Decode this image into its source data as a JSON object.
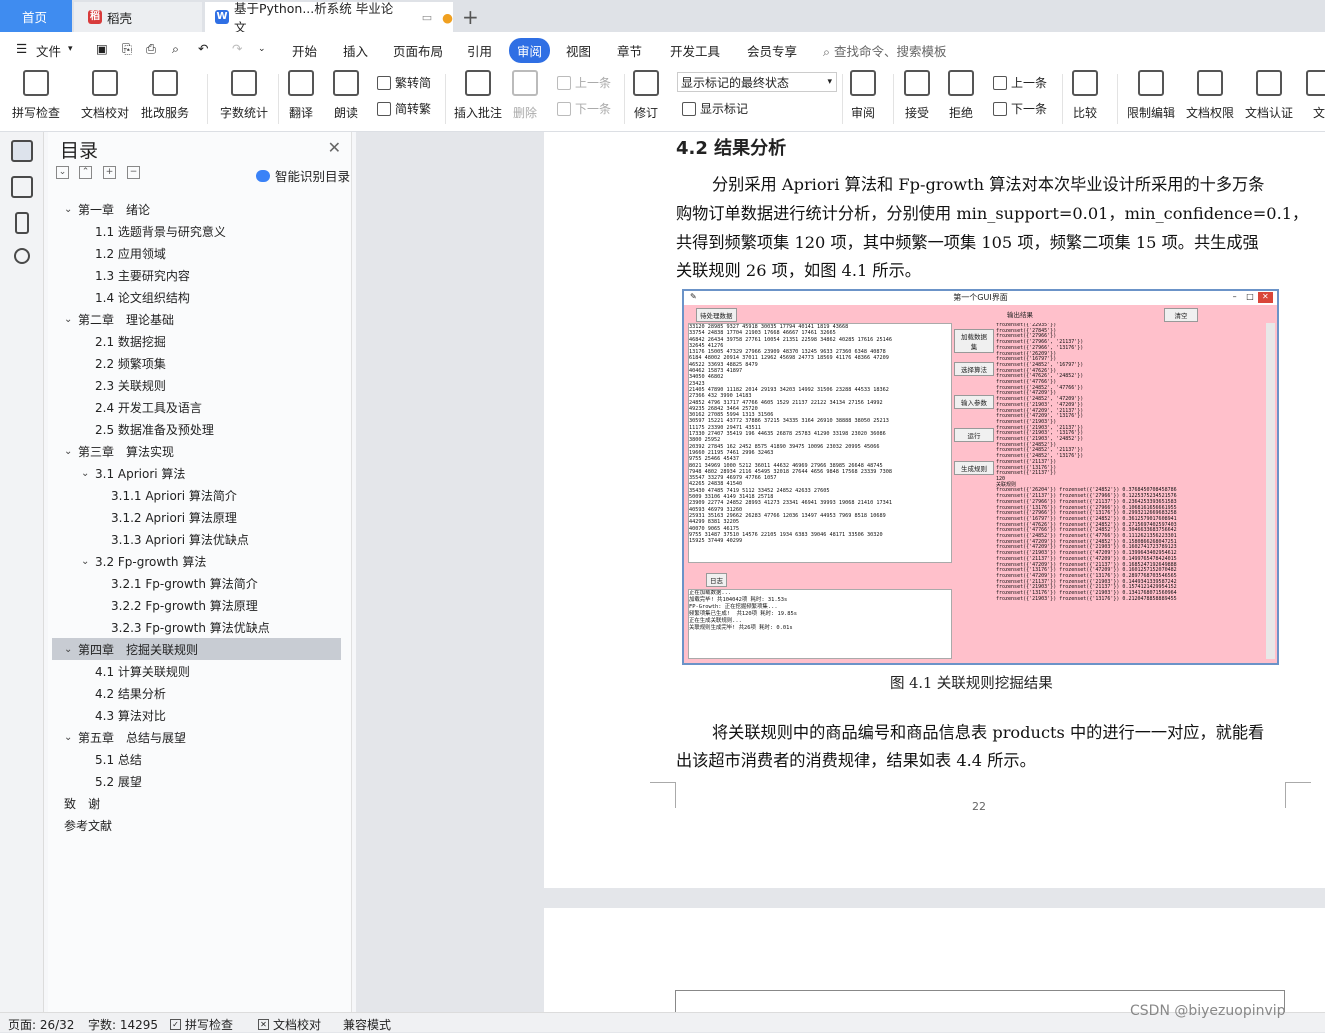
{
  "tabs": {
    "home": "首页",
    "daoke": "稻壳",
    "doc": "基于Python...析系统 毕业论文"
  },
  "menubar": {
    "file": "文件",
    "items": [
      "开始",
      "插入",
      "页面布局",
      "引用",
      "审阅",
      "视图",
      "章节",
      "开发工具",
      "会员专享"
    ],
    "search": "查找命令、搜索模板"
  },
  "ribbon": {
    "spell": "拼写检查",
    "doc_check": "文档校对",
    "annotate_service": "批改服务",
    "word_count": "字数统计",
    "translate": "翻译",
    "read_aloud": "朗读",
    "trad_to_simp": "繁转简",
    "simp_to_trad": "简转繁",
    "insert_comment": "插入批注",
    "delete": "删除",
    "prev_comment": "上一条",
    "next_comment": "下一条",
    "revise": "修订",
    "display_mode": "显示标记的最终状态",
    "show_markup": "显示标记",
    "review": "审阅",
    "accept": "接受",
    "reject": "拒绝",
    "prev": "上一条",
    "next": "下一条",
    "compare": "比较",
    "restrict_edit": "限制编辑",
    "doc_permission": "文档权限",
    "doc_cert": "文档认证",
    "doc_more": "文"
  },
  "toc": {
    "title": "目录",
    "smart_label": "智能识别目录",
    "items": [
      {
        "text": "第一章　绪论",
        "level": 0,
        "chev": "⌄"
      },
      {
        "text": "1.1  选题背景与研究意义",
        "level": 1
      },
      {
        "text": "1.2  应用领域",
        "level": 1
      },
      {
        "text": "1.3  主要研究内容",
        "level": 1
      },
      {
        "text": "1.4  论文组织结构",
        "level": 1
      },
      {
        "text": "第二章　理论基础",
        "level": 0,
        "chev": "⌄"
      },
      {
        "text": "2.1  数据挖掘",
        "level": 1
      },
      {
        "text": "2.2  频繁项集",
        "level": 1
      },
      {
        "text": "2.3  关联规则",
        "level": 1
      },
      {
        "text": "2.4  开发工具及语言",
        "level": 1
      },
      {
        "text": "2.5  数据准备及预处理",
        "level": 1
      },
      {
        "text": "第三章　算法实现",
        "level": 0,
        "chev": "⌄"
      },
      {
        "text": "3.1 Apriori 算法",
        "level": 1,
        "chev": "⌄"
      },
      {
        "text": "3.1.1 Apriori 算法简介",
        "level": 2
      },
      {
        "text": "3.1.2 Apriori 算法原理",
        "level": 2
      },
      {
        "text": "3.1.3 Apriori 算法优缺点",
        "level": 2
      },
      {
        "text": "3.2 Fp-growth 算法",
        "level": 1,
        "chev": "⌄"
      },
      {
        "text": "3.2.1 Fp-growth 算法简介",
        "level": 2
      },
      {
        "text": "3.2.2 Fp-growth 算法原理",
        "level": 2
      },
      {
        "text": "3.2.3 Fp-growth 算法优缺点",
        "level": 2
      },
      {
        "text": "第四章　挖掘关联规则",
        "level": 0,
        "chev": "⌄",
        "selected": true
      },
      {
        "text": "4.1  计算关联规则",
        "level": 1
      },
      {
        "text": "4.2  结果分析",
        "level": 1
      },
      {
        "text": "4.3  算法对比",
        "level": 1
      },
      {
        "text": "第五章　总结与展望",
        "level": 0,
        "chev": "⌄"
      },
      {
        "text": "5.1  总结",
        "level": 1
      },
      {
        "text": "5.2  展望",
        "level": 1
      },
      {
        "text": "致　谢",
        "level": 0
      },
      {
        "text": "参考文献",
        "level": 0
      }
    ]
  },
  "doc": {
    "heading": "4.2  结果分析",
    "para1": [
      "分别采用 Apriori 算法和 Fp-growth 算法对本次毕业设计所采用的十多万条",
      "购物订单数据进行统计分析，分别使用 min_support=0.01，min_confidence=0.1，",
      "共得到频繁项集 120 项，其中频繁一项集 105 项，频繁二项集 15 项。共生成强",
      "关联规则 26 项，如图 4.1 所示。"
    ],
    "caption": "图  4.1    关联规则挖掘结果",
    "para2": [
      "将关联规则中的商品编号和商品信息表 products 中的进行一一对应，就能看",
      "出该超市消费者的消费规律，结果如表 4.4 所示。"
    ],
    "page_number": "22"
  },
  "figure": {
    "window_title": "第一个GUI界面",
    "btn_pending": "待处理数据",
    "btn_output": "输出结果",
    "btn_clear": "清空",
    "btn_load": "加载数据集",
    "btn_algo": "选择算法",
    "btn_params": "输入参数",
    "btn_run": "运行",
    "btn_rules": "生成规则",
    "log_label": "日志",
    "data_text": "33120 28985 9327 45918 30035 17794 40141 1819 43668\n33754 24838 17704 21903 17668 46667 17461 32665\n46842 26434 39758 27761 10054 21351 22598 34862 40285 17616 25146\n32645 41276\n13176 15005 47329 27966 23909 48370 13245 9633 27360 6348 40878\n6184 48002 20914 37011 12962 45698 24773 18569 41176 48366 47209\n46522 33693 48825 8479\n40462 15873 41897\n34050 46802\n23423\n21405 47890 11182 2014 29193 34203 14992 31506 23288 44533 18362\n27366 432 3990 14183\n24852 4796 31717 47766 4605 1529 21137 22122 34134 27156 14992\n49235 26842 3464 25720\n30162 27085 5994 1313 31506\n30597 15221 43772 37886 37215 34335 3164 26910 38888 38050 25213\n11175 23390 29471 43511\n17330 27407 35419 196 44635 26878 25783 41290 33198 23020 36086\n3800 25952\n20392 27845 162 2452 8575 41890 39475 10096 23032 20995 45066\n19660 21195 7461 2996 32463\n9755 25466 45437\n8021 34969 1000 5212 36011 44632 46969 27966 38985 26648 48745\n7948 4802 28934 2116 45495 32018 27644 4656 9848 17568 23339 7308\n35547 33279 46979 47766 1057\n42265 24838 41540\n35430 47485 7419 5112 33452 24852 42633 27605\n5009 33106 4149 31418 25718\n23909 22774 24852 28993 41273 23341 46941 39993 19068 21410 17341\n40593 46979 31260\n25931 35163 29662 26283 47766 12036 13497 44953 7969 8518 10689\n44299 8381 32205\n40070 9065 46175\n9755 31487 37510 14576 22105 1934 6383 39046 48171 33506 30320\n15925 37449 40299",
    "log_text": "正在加载数据...\n加载完毕! 共104042项 耗时: 31.53s\nFP-Growth: 正在挖掘频繁项集...\n频繁项集已生成!  共120项 耗时: 19.85s\n正在生成关联规则...\n关联规则生成完毕! 共26项 耗时: 0.01s",
    "output_text": "frozenset({'22935'})\nfrozenset({'27845'})\nfrozenset({'27966'})\nfrozenset({'27966', '21137'})\nfrozenset({'27966', '13176'})\nfrozenset({'26209'})\nfrozenset({'16797'})\nfrozenset({'24852', '16797'})\nfrozenset({'47626'})\nfrozenset({'47626', '24852'})\nfrozenset({'47766'})\nfrozenset({'24852', '47766'})\nfrozenset({'47209'})\nfrozenset({'24852', '47209'})\nfrozenset({'21903', '47209'})\nfrozenset({'47209', '21137'})\nfrozenset({'47209', '13176'})\nfrozenset({'21903'})\nfrozenset({'21903', '21137'})\nfrozenset({'21903', '13176'})\nfrozenset({'21903', '24852'})\nfrozenset({'24852'})\nfrozenset({'24852', '21137'})\nfrozenset({'24852', '13176'})\nfrozenset({'21137'})\nfrozenset({'13176'})\nfrozenset({'21137'})\n120\n关联规则\nfrozenset({'26204'}) frozenset({'24852'}) 0.3768450708458786\nfrozenset({'21137'}) frozenset({'27966'}) 0.1225375234521576\nfrozenset({'27966'}) frozenset({'21137'}) 0.2364253393651583\nfrozenset({'13176'}) frozenset({'27966'}) 0.1068161656661955\nfrozenset({'27966'}) frozenset({'13176'}) 0.2993212669683258\nfrozenset({'16797'}) frozenset({'24852'}) 0.3612579017608941\nfrozenset({'47626'}) frozenset({'24852'}) 0.2715697402597403\nfrozenset({'47766'}) frozenset({'24852'}) 0.3046633683756642\nfrozenset({'24852'}) frozenset({'47766'}) 0.1112621356223301\nfrozenset({'47209'}) frozenset({'24852'}) 0.1580866268047251\nfrozenset({'47209'}) frozenset({'21903'}) 0.1602741723789123\nfrozenset({'21903'}) frozenset({'47209'}) 0.1399643402954612\nfrozenset({'21137'}) frozenset({'47209'}) 0.1499765478424015\nfrozenset({'47209'}) frozenset({'21137'}) 0.1685247192649888\nfrozenset({'13176'}) frozenset({'47209'}) 0.1601257152070482\nfrozenset({'47209'}) frozenset({'13176'}) 0.2897768703546565\nfrozenset({'21137'}) frozenset({'21903'}) 0.1449341339587242\nfrozenset({'21903'}) frozenset({'21137'}) 0.1574121429954152\nfrozenset({'13176'}) frozenset({'21903'}) 0.1341768071560964\nfrozenset({'21903'}) frozenset({'13176'}) 0.2120478858889455"
  },
  "status": {
    "page": "页面: 26/32",
    "words": "字数: 14295",
    "spell": "拼写检查",
    "doc_check": "文档校对",
    "compat": "兼容模式"
  },
  "watermark": "CSDN @biyezuopinvip"
}
